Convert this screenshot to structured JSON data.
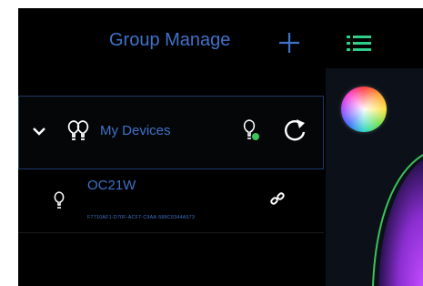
{
  "header": {
    "title": "Group Manage",
    "add_icon": "plus-icon",
    "menu_icon": "list-icon"
  },
  "group": {
    "label": "My Devices",
    "expand_icon": "chevron-down-icon",
    "group_icon": "bulbs-icon",
    "status_icon": "bulb-status-icon",
    "refresh_icon": "refresh-icon"
  },
  "device": {
    "name": "OC21W",
    "id": "F7710AF1-D70F-ACF7-C9AA-588C0344A573",
    "bulb_icon": "bulb-icon",
    "link_icon": "link-icon"
  },
  "colors": {
    "background": "#000000",
    "accent": "#3f72c9",
    "status_green": "#3cc35a",
    "panel": "#0c1018"
  }
}
